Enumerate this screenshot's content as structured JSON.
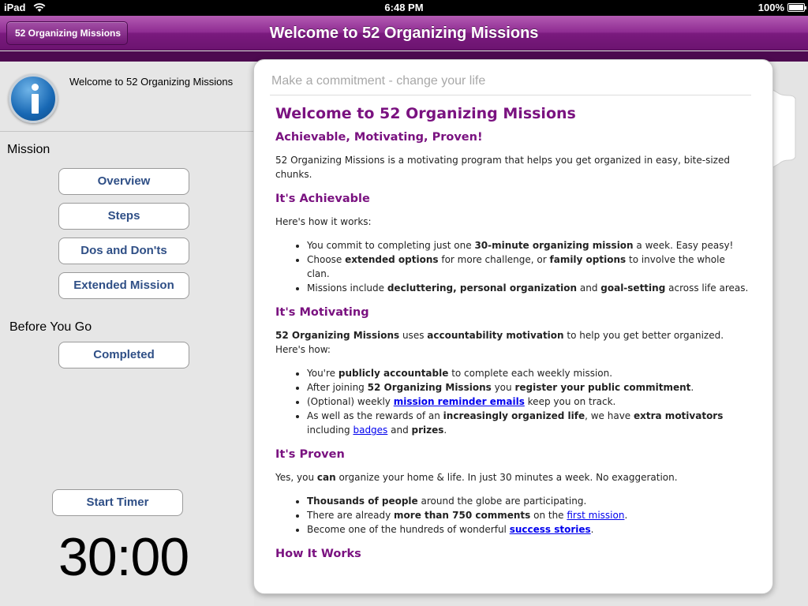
{
  "status_bar": {
    "device": "iPad",
    "time": "6:48 PM",
    "battery": "100%"
  },
  "nav": {
    "back_label": "52 Organizing Missions",
    "title": "Welcome to 52 Organizing Missions"
  },
  "sidebar": {
    "info_label": "Welcome to 52 Organizing Missions",
    "mission_heading": "Mission",
    "mission_buttons": [
      "Overview",
      "Steps",
      "Dos and Don'ts",
      "Extended Mission"
    ],
    "before_heading": "Before You Go",
    "completed_label": "Completed",
    "timer_button": "Start Timer",
    "timer_value": "30:00"
  },
  "popover": {
    "tagline": "Make a commitment - change your life",
    "title": "Welcome to 52 Organizing Missions",
    "subtitle": "Achievable, Motivating, Proven!",
    "intro": "52 Organizing Missions is a motivating program that helps you get organized in easy, bite-sized chunks.",
    "achievable": {
      "heading": "It's Achievable",
      "lead": "Here's how it works:",
      "li1": [
        "You commit to completing just one ",
        "30-minute organizing mission",
        " a week. Easy peasy!"
      ],
      "li2": [
        "Choose ",
        "extended options",
        " for more challenge, or ",
        "family options",
        " to involve the whole clan."
      ],
      "li3": [
        "Missions include ",
        "decluttering, personal organization",
        " and ",
        "goal-setting",
        " across life areas."
      ]
    },
    "motivating": {
      "heading": "It's Motivating",
      "lead": [
        "52 Organizing Missions",
        " uses ",
        "accountability motivation",
        " to help you get better organized. Here's how:"
      ],
      "li1": [
        "You're ",
        "publicly accountable",
        " to complete each weekly mission."
      ],
      "li2": [
        "After joining ",
        "52 Organizing Missions",
        " you ",
        "register your public commitment",
        "."
      ],
      "li3": [
        "(Optional) weekly ",
        "mission reminder emails",
        " keep you on track."
      ],
      "li4": [
        "As well as the rewards of an ",
        "increasingly organized life",
        ", we have ",
        "extra motivators",
        " including ",
        "badges",
        " and ",
        "prizes",
        "."
      ]
    },
    "proven": {
      "heading": "It's Proven",
      "lead": [
        "Yes, you ",
        "can",
        " organize your home & life. In just 30 minutes a week. No exaggeration."
      ],
      "li1": [
        "Thousands of people",
        " around the globe are participating."
      ],
      "li2": [
        "There are already ",
        "more than 750 comments",
        " on the ",
        "first mission",
        "."
      ],
      "li3": [
        "Become one of the hundreds of wonderful ",
        "success stories",
        "."
      ]
    },
    "next_heading": "How It Works"
  }
}
